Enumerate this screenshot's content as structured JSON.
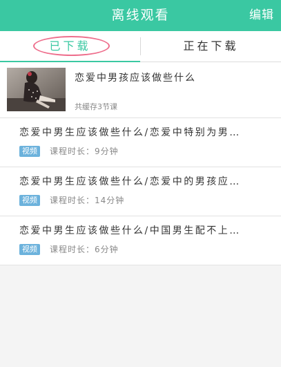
{
  "header": {
    "title": "离线观看",
    "edit_label": "编辑",
    "background_color": "#3ac8a2"
  },
  "tabs": {
    "downloaded_label": "已下载",
    "downloading_label": "正在下载",
    "active_color": "#3ac8a2",
    "highlight_color": "#ee6e8c"
  },
  "course": {
    "title": "恋爱中男孩应该做些什么",
    "cached_text": "共缓存3节课",
    "thumbnail_icon": "course-thumbnail"
  },
  "videos": [
    {
      "title": "恋爱中男生应该做些什么/恋爱中特别为男…",
      "badge": "视频",
      "duration": "课程时长：9分钟"
    },
    {
      "title": "恋爱中男生应该做些什么/恋爱中的男孩应…",
      "badge": "视频",
      "duration": "课程时长：14分钟"
    },
    {
      "title": "恋爱中男生应该做些什么/中国男生配不上…",
      "badge": "视频",
      "duration": "课程时长：6分钟"
    }
  ]
}
